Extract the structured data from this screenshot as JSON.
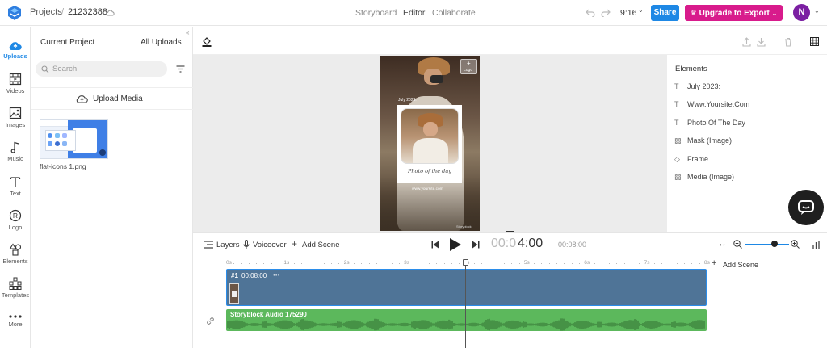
{
  "header": {
    "breadcrumb_root": "Projects",
    "separator": "/",
    "project_id": "21232388",
    "modes": [
      "Storyboard",
      "Editor",
      "Collaborate"
    ],
    "aspect": "9:16",
    "share_label": "Share",
    "upgrade_label": "Upgrade to Export",
    "avatar_initial": "N"
  },
  "rail": [
    {
      "label": "Uploads",
      "icon": "upload-cloud-icon"
    },
    {
      "label": "Videos",
      "icon": "film-icon"
    },
    {
      "label": "Images",
      "icon": "image-icon"
    },
    {
      "label": "Music",
      "icon": "music-note-icon"
    },
    {
      "label": "Text",
      "icon": "text-icon"
    },
    {
      "label": "Logo",
      "icon": "logo-r-icon"
    },
    {
      "label": "Elements",
      "icon": "shapes-icon"
    },
    {
      "label": "Templates",
      "icon": "templates-icon"
    },
    {
      "label": "More",
      "icon": "more-dots-icon"
    }
  ],
  "panel": {
    "tab_current": "Current Project",
    "tab_all": "All Uploads",
    "search_placeholder": "Search",
    "upload_label": "Upload Media",
    "file_name": "flat-icons 1.png"
  },
  "canvas": {
    "logo_label": "Logo",
    "date_text": "July 2023:",
    "script_text": "Photo of the day",
    "site_text": "www.yoursite.com",
    "corner_text": "Storyblock"
  },
  "elements": {
    "title": "Elements",
    "items": [
      {
        "icon": "T",
        "label": "July 2023:"
      },
      {
        "icon": "T",
        "label": "Www.Yoursite.Com"
      },
      {
        "icon": "T",
        "label": "Photo Of The Day"
      },
      {
        "icon": "▨",
        "label": "Mask (Image)"
      },
      {
        "icon": "◇",
        "label": "Frame"
      },
      {
        "icon": "▨",
        "label": "Media (Image)"
      }
    ]
  },
  "timeline": {
    "layers_label": "Layers",
    "voiceover_label": "Voiceover",
    "add_scene_label": "Add Scene",
    "time_dim": "00:0",
    "time_main": "4:00",
    "duration": "00:08:00",
    "ruler": [
      "0s",
      "1s",
      "2s",
      "3s",
      "4s",
      "5s",
      "6s",
      "7s",
      "8s"
    ],
    "add_scene_right": "Add Scene",
    "scene_label": "#1",
    "scene_duration": "00:08:00",
    "scene_more": "•••",
    "audio_label": "Storyblock Audio 175290",
    "playhead_fraction": 0.5
  },
  "colors": {
    "accent": "#1e88e5",
    "upgrade": "#d81b8c",
    "avatar": "#7b1fa2",
    "video_track": "#4f7497",
    "audio_track": "#5cb85c"
  }
}
